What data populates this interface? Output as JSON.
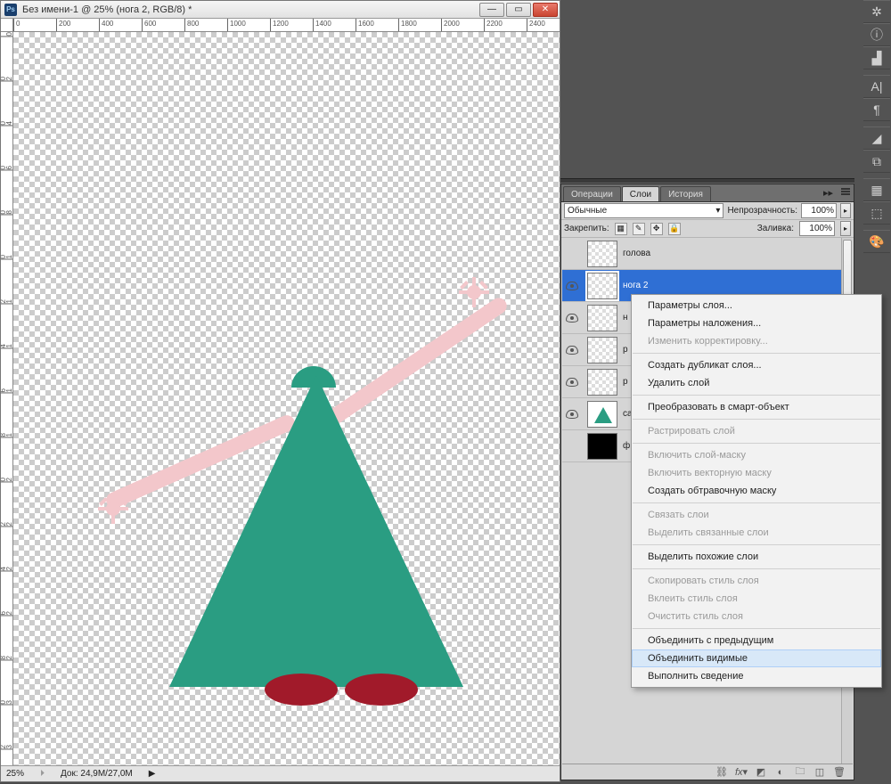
{
  "window": {
    "title": "Без имени-1 @ 25% (нога 2, RGB/8) *"
  },
  "status": {
    "zoom": "25%",
    "doc": "Док: 24,9M/27,0M"
  },
  "ruler_marks_h": [
    "0",
    "200",
    "400",
    "600",
    "800",
    "1000",
    "1200",
    "1400",
    "1600",
    "1800",
    "2000",
    "2200",
    "2400"
  ],
  "ruler_marks_v": [
    "0",
    "200",
    "400",
    "600",
    "800",
    "1000",
    "1200",
    "1400",
    "1600",
    "1800",
    "2000",
    "2200",
    "2400",
    "2600",
    "2800",
    "3000",
    "3200"
  ],
  "panels": {
    "tabs": {
      "ops": "Операции",
      "layers": "Слои",
      "hist": "История"
    },
    "blend_mode": "Обычные",
    "opacity_label": "Непрозрачность:",
    "opacity_value": "100%",
    "lock_label": "Закрепить:",
    "fill_label": "Заливка:",
    "fill_value": "100%"
  },
  "layers": [
    {
      "name": "голова",
      "visible": false,
      "sel": false,
      "thumb": "checker"
    },
    {
      "name": "нога 2",
      "visible": true,
      "sel": true,
      "thumb": "checker"
    },
    {
      "name": "н",
      "visible": true,
      "sel": false,
      "thumb": "checker"
    },
    {
      "name": "р",
      "visible": true,
      "sel": false,
      "thumb": "checker"
    },
    {
      "name": "р",
      "visible": true,
      "sel": false,
      "thumb": "checker"
    },
    {
      "name": "са",
      "visible": true,
      "sel": false,
      "thumb": "tri"
    },
    {
      "name": "ф",
      "visible": false,
      "sel": false,
      "thumb": "black"
    }
  ],
  "context_menu": [
    {
      "t": "item",
      "label": "Параметры слоя..."
    },
    {
      "t": "item",
      "label": "Параметры наложения..."
    },
    {
      "t": "disabled",
      "label": "Изменить корректировку..."
    },
    {
      "t": "sep"
    },
    {
      "t": "item",
      "label": "Создать дубликат слоя..."
    },
    {
      "t": "item",
      "label": "Удалить слой"
    },
    {
      "t": "sep"
    },
    {
      "t": "item",
      "label": "Преобразовать в смарт-объект"
    },
    {
      "t": "sep"
    },
    {
      "t": "disabled",
      "label": "Растрировать слой"
    },
    {
      "t": "sep"
    },
    {
      "t": "disabled",
      "label": "Включить слой-маску"
    },
    {
      "t": "disabled",
      "label": "Включить векторную маску"
    },
    {
      "t": "item",
      "label": "Создать обтравочную маску"
    },
    {
      "t": "sep"
    },
    {
      "t": "disabled",
      "label": "Связать слои"
    },
    {
      "t": "disabled",
      "label": "Выделить связанные слои"
    },
    {
      "t": "sep"
    },
    {
      "t": "item",
      "label": "Выделить похожие слои"
    },
    {
      "t": "sep"
    },
    {
      "t": "disabled",
      "label": "Скопировать стиль слоя"
    },
    {
      "t": "disabled",
      "label": "Вклеить стиль слоя"
    },
    {
      "t": "disabled",
      "label": "Очистить стиль слоя"
    },
    {
      "t": "sep"
    },
    {
      "t": "item",
      "label": "Объединить с предыдущим"
    },
    {
      "t": "hovered",
      "label": "Объединить видимые"
    },
    {
      "t": "item",
      "label": "Выполнить сведение"
    }
  ]
}
